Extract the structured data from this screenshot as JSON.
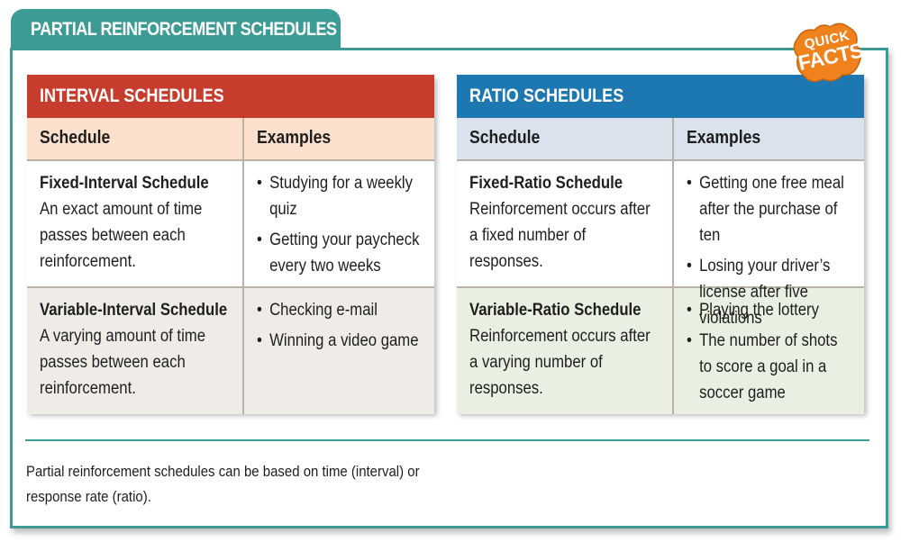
{
  "title": "PARTIAL REINFORCEMENT SCHEDULES",
  "badge": {
    "line1": "QUICK",
    "line2": "FACTS",
    "color": "#f0821e"
  },
  "colors": {
    "frame": "#3d9b95",
    "interval_header": "#c63c2d",
    "ratio_header": "#1d77b0"
  },
  "interval": {
    "header": "INTERVAL SCHEDULES",
    "columns": [
      "Schedule",
      "Examples"
    ],
    "rows": [
      {
        "name": "Fixed-Interval Schedule",
        "description": "An exact amount of time passes between each reinforcement.",
        "examples": [
          "Studying for a weekly quiz",
          "Getting your paycheck every two weeks"
        ]
      },
      {
        "name": "Variable-Interval Schedule",
        "description": "A varying amount of time passes between each reinforcement.",
        "examples": [
          "Checking e-mail",
          "Winning a video game"
        ]
      }
    ]
  },
  "ratio": {
    "header": "RATIO SCHEDULES",
    "columns": [
      "Schedule",
      "Examples"
    ],
    "rows": [
      {
        "name": "Fixed-Ratio Schedule",
        "description": "Reinforcement occurs after a fixed number of responses.",
        "examples": [
          "Getting one free meal after the purchase of ten",
          "Losing your driver’s license after five violations"
        ]
      },
      {
        "name": "Variable-Ratio Schedule",
        "description": "Reinforcement occurs after a varying number of responses.",
        "examples": [
          "Playing the lottery",
          "The number of shots to score a goal in a soccer game"
        ]
      }
    ]
  },
  "caption": "Partial reinforcement schedules can be based on time (interval) or response rate (ratio)."
}
